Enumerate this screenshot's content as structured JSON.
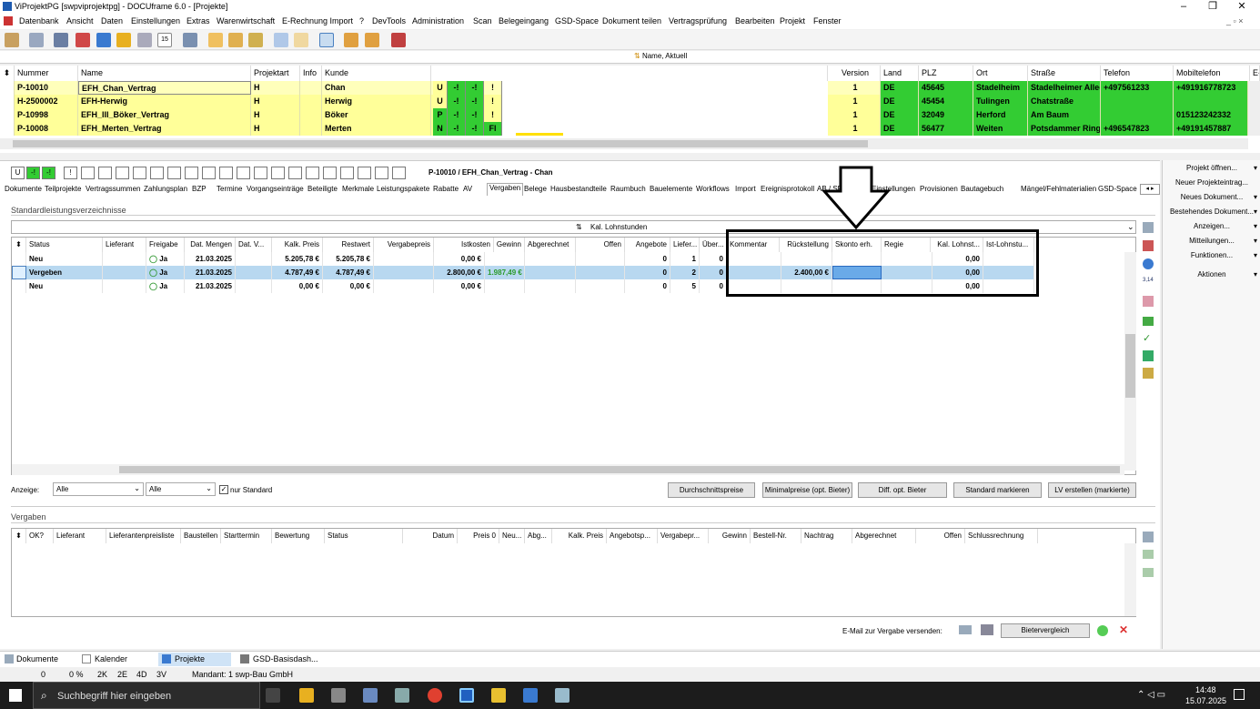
{
  "window": {
    "title": "ViProjektPG [swpviprojektpg] - DOCUframe 6.0 - [Projekte]",
    "min": "–",
    "max": "❐",
    "close": "✕"
  },
  "menu": [
    "Datenbank",
    "Ansicht",
    "Daten",
    "Einstellungen",
    "Extras",
    "Warenwirtschaft",
    "E-Rechnung Import",
    "?",
    "DevTools",
    "Administration",
    "Scan",
    "Belegeingang",
    "GSD-Space",
    "Dokument teilen",
    "Vertragsprüfung",
    "Bearbeiten",
    "Projekt",
    "Fenster"
  ],
  "filter": {
    "value": "Name, Aktuell"
  },
  "projects": {
    "headers": [
      "Nummer",
      "Name",
      "Projektart",
      "Info",
      "Kunde",
      "Version",
      "Land",
      "PLZ",
      "Ort",
      "Straße",
      "Telefon",
      "Mobiltelefon",
      "E-"
    ],
    "rows": [
      {
        "nummer": "P-10010",
        "name": "EFH_Chan_Vertrag",
        "art": "H",
        "kunde": "Chan",
        "flags": [
          "U",
          "-!",
          "-!",
          "!"
        ],
        "version": "1",
        "land": "DE",
        "plz": "45645",
        "ort": "Stadelheim",
        "strasse": "Stadelheimer Allee",
        "telefon": "+497561233",
        "mobil": "+491916778723"
      },
      {
        "nummer": "H-2500002",
        "name": "EFH-Herwig",
        "art": "H",
        "kunde": "Herwig",
        "flags": [
          "U",
          "-!",
          "-!",
          "!"
        ],
        "version": "1",
        "land": "DE",
        "plz": "45454",
        "ort": "Tulingen",
        "strasse": "Chatstraße",
        "telefon": "",
        "mobil": ""
      },
      {
        "nummer": "P-10998",
        "name": "EFH_III_Böker_Vertrag",
        "art": "H",
        "kunde": "Böker",
        "flags": [
          "P",
          "-!",
          "-!",
          "!"
        ],
        "version": "1",
        "land": "DE",
        "plz": "32049",
        "ort": "Herford",
        "strasse": "Am Baum",
        "telefon": "",
        "mobil": "015123242332"
      },
      {
        "nummer": "P-10008",
        "name": "EFH_Merten_Vertrag",
        "art": "H",
        "kunde": "Merten",
        "flags": [
          "N",
          "-!",
          "-!",
          "Fl"
        ],
        "version": "1",
        "land": "DE",
        "plz": "56477",
        "ort": "Weiten",
        "strasse": "Potsdammer Ring",
        "telefon": "+496547823",
        "mobil": "+49191457887"
      }
    ]
  },
  "detail": {
    "status_flags": [
      "U",
      "-!",
      "-!",
      "!"
    ],
    "project_label": "P-10010 / EFH_Chan_Vertrag - Chan",
    "tabs": [
      "Dokumente",
      "Teilprojekte",
      "Vertragssummen",
      "Zahlungsplan",
      "BZP",
      "Termine",
      "Vorgangseinträge",
      "Beteiligte",
      "Merkmale",
      "Leistungspakete",
      "Rabatte",
      "AV",
      "Vergaben",
      "Belege",
      "Hausbestandteile",
      "Raumbuch",
      "Bauelemente",
      "Workflows",
      "Import",
      "Ereignisprotokoll",
      "AB / SF",
      "Suche",
      "Einstellungen",
      "Provisionen",
      "Bautagebuch",
      "Mängel/Fehlmaterialien",
      "GSD-Space"
    ],
    "active_tab": "Vergaben",
    "section1": "Standardleistungsverzeichnisse",
    "sort_label": "Kal. Lohnstunden",
    "slv": {
      "headers": [
        "Status",
        "Lieferant",
        "Freigabe",
        "Dat. Mengen",
        "Dat. V...",
        "Kalk. Preis",
        "Restwert",
        "Vergabepreis",
        "Istkosten",
        "Gewinn",
        "Abgerechnet",
        "Offen",
        "Angebote",
        "Liefer...",
        "Über...",
        "Kommentar",
        "Rückstellung",
        "Skonto erh.",
        "Regie",
        "Kal. Lohnst...",
        "Ist-Lohnstu..."
      ],
      "rows": [
        {
          "status": "Neu",
          "freigabe": "Ja",
          "datum": "21.03.2025",
          "kalk": "5.205,78 €",
          "rest": "5.205,78 €",
          "ist": "0,00 €",
          "gewinn": "",
          "angebote": "0",
          "liefer": "1",
          "ueber": "0",
          "rueck": "",
          "lohn": "0,00"
        },
        {
          "status": "Vergeben",
          "freigabe": "Ja",
          "datum": "21.03.2025",
          "kalk": "4.787,49 €",
          "rest": "4.787,49 €",
          "ist": "2.800,00 €",
          "gewinn": "1.987,49 €",
          "angebote": "0",
          "liefer": "2",
          "ueber": "0",
          "rueck": "2.400,00 €",
          "lohn": "0,00"
        },
        {
          "status": "Neu",
          "freigabe": "Ja",
          "datum": "21.03.2025",
          "kalk": "0,00 €",
          "rest": "0,00 €",
          "ist": "0,00 €",
          "gewinn": "",
          "angebote": "0",
          "liefer": "5",
          "ueber": "0",
          "rueck": "",
          "lohn": "0,00"
        }
      ]
    },
    "anzeige_label": "Anzeige:",
    "anzeige1": "Alle",
    "anzeige2": "Alle",
    "nur_standard": "nur Standard",
    "buttons": [
      "Durchschnittspreise",
      "Minimalpreise (opt. Bieter)",
      "Diff. opt. Bieter",
      "Standard markieren",
      "LV erstellen (markierte)"
    ],
    "section2": "Vergaben",
    "vergaben_headers": [
      "OK?",
      "Lieferant",
      "Lieferantenpreisliste",
      "Baustellen",
      "Starttermin",
      "Bewertung",
      "Status",
      "Datum",
      "Preis 0",
      "Neu...",
      "Abg...",
      "Kalk. Preis",
      "Angebotsp...",
      "Vergabepr...",
      "Gewinn",
      "Bestell-Nr.",
      "Nachtrag",
      "Abgerechnet",
      "Offen",
      "Schlussrechnung"
    ],
    "email_label": "E-Mail zur Vergabe versenden:",
    "bietervergleich": "Bietervergleich"
  },
  "right_panel": [
    "Projekt öffnen...",
    "Neuer Projekteintrag...",
    "Neues Dokument...",
    "Bestehendes Dokument...",
    "Anzeigen...",
    "Mitteilungen...",
    "Funktionen...",
    "Aktionen"
  ],
  "bottom_tabs": [
    "Dokumente",
    "Kalender",
    "Projekte",
    "GSD-Basisdash..."
  ],
  "status": {
    "a": "0",
    "b": "0 %",
    "c": "2K",
    "d": "2E",
    "e": "4D",
    "f": "3V",
    "mandant": "Mandant: 1 swp-Bau GmbH"
  },
  "taskbar": {
    "search": "Suchbegriff hier eingeben",
    "time": "14:48",
    "date": "15.07.2025"
  },
  "colors": {
    "yellow_row": "#ffff99",
    "selected_row": "#ffffbb",
    "green": "#33cc33",
    "blue_sel": "#b8d8f0"
  }
}
